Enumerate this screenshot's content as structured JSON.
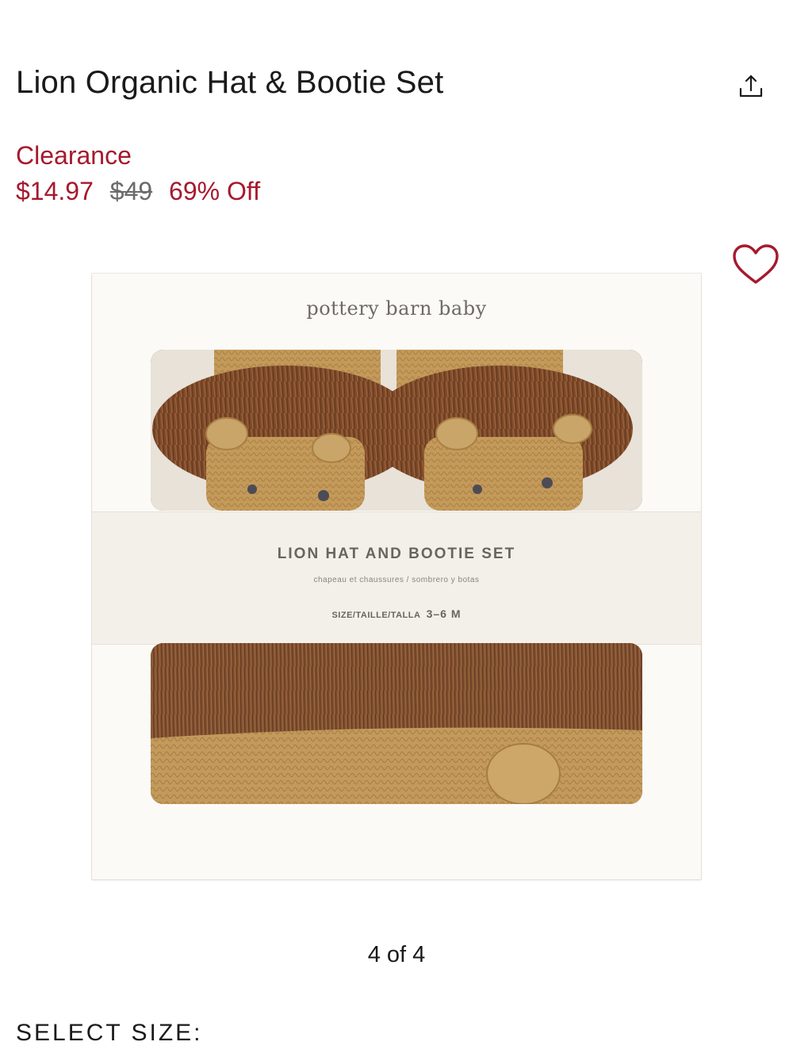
{
  "product": {
    "title": "Lion Organic Hat & Bootie Set",
    "badge": "Clearance",
    "sale_price": "$14.97",
    "original_price": "$49",
    "discount": "69% Off"
  },
  "icons": {
    "share": "share-icon",
    "favorite": "heart-icon"
  },
  "image": {
    "brand": "pottery barn baby",
    "band_title": "LION HAT AND BOOTIE SET",
    "band_subtitle": "chapeau et chaussures / sombrero y botas",
    "size_label": "SIZE/TAILLE/TALLA",
    "size_value": "3–6 M"
  },
  "gallery": {
    "pager": "4 of 4"
  },
  "size_selector": {
    "label": "SELECT SIZE:"
  },
  "colors": {
    "sale_red": "#a6192e",
    "text": "#1a1a1a",
    "muted": "#6b6b6b",
    "knit_tan": "#c49a5a",
    "mane_brown": "#7a4a2c"
  }
}
